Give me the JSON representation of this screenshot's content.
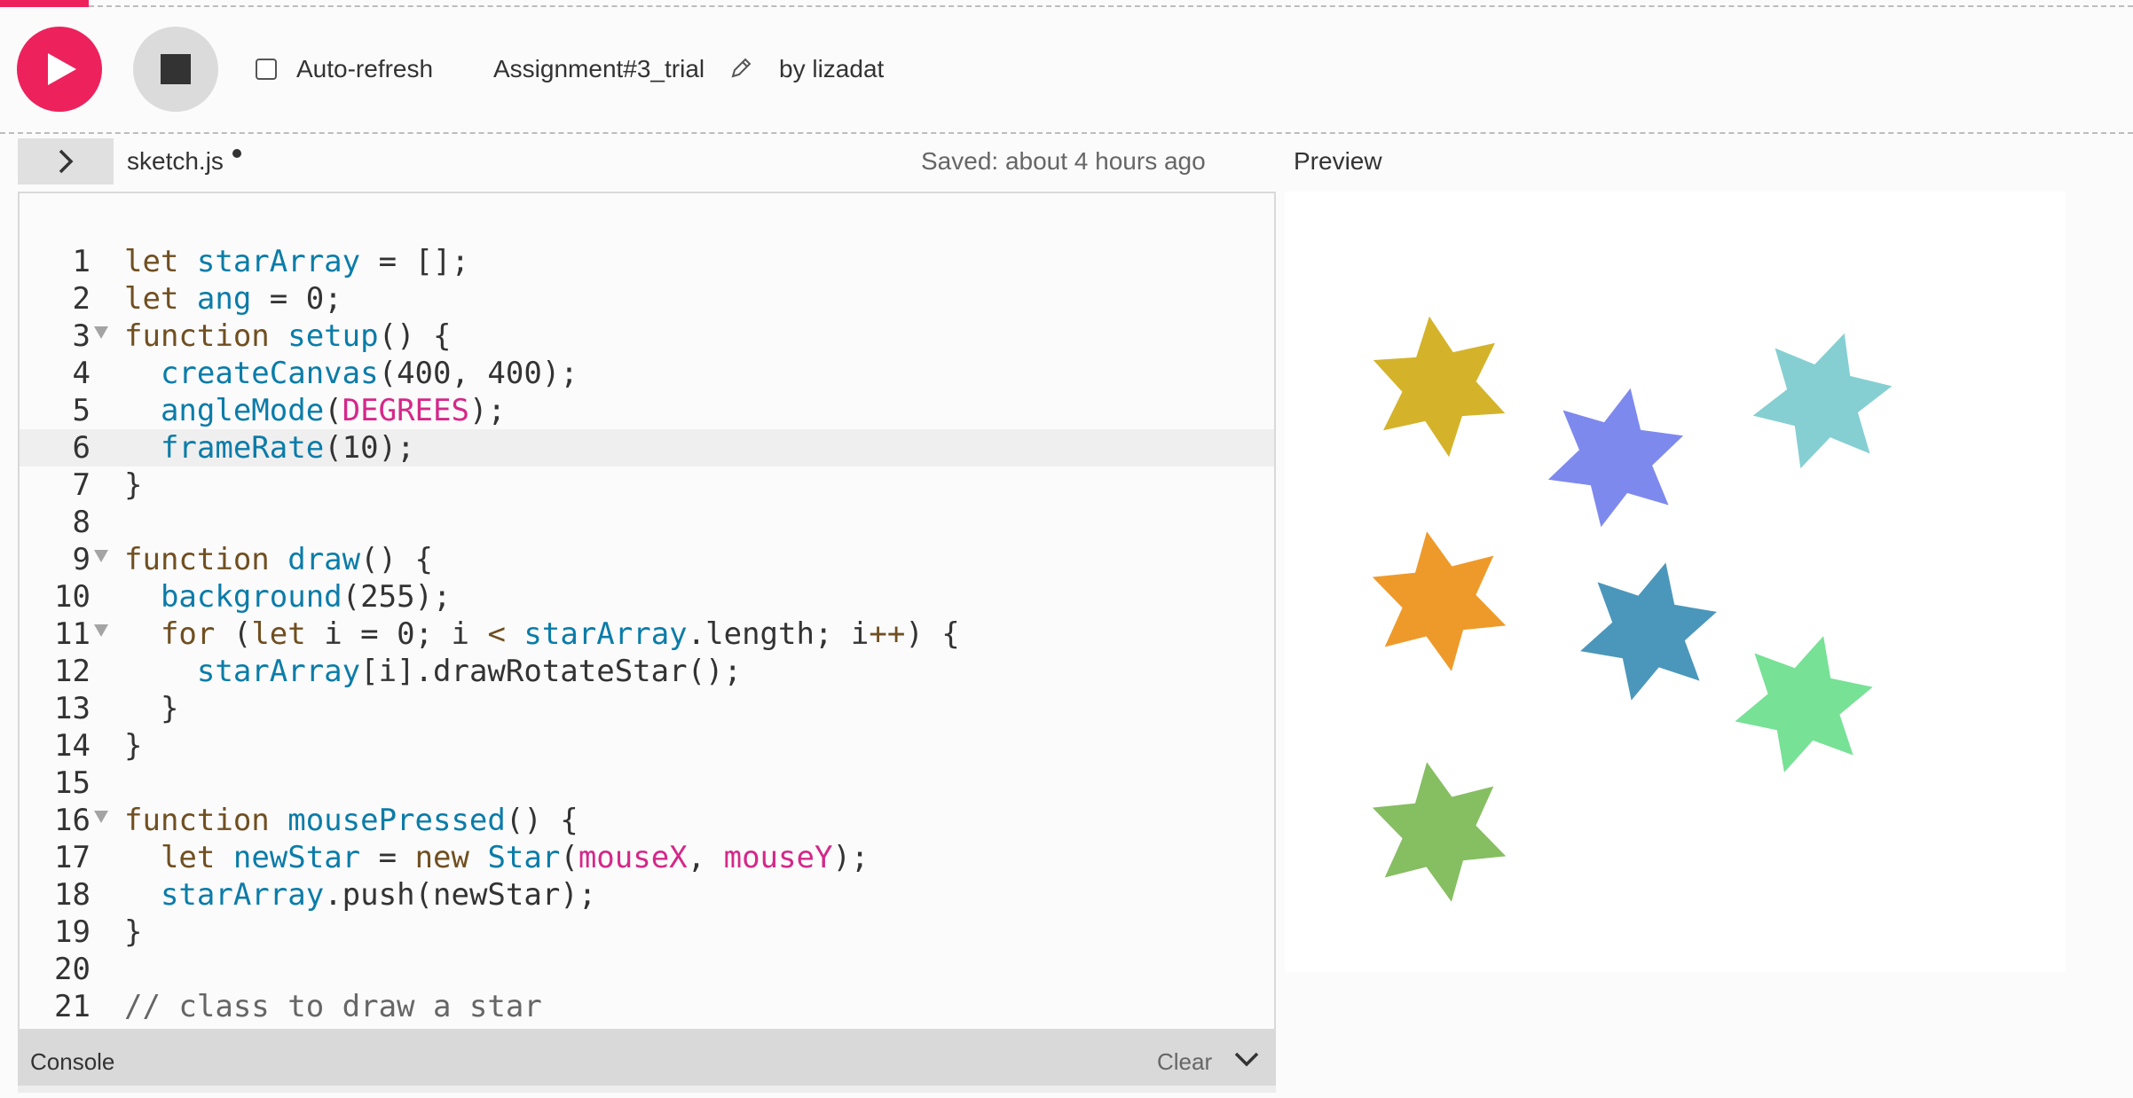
{
  "toolbar": {
    "play_label": "Play",
    "stop_label": "Stop",
    "autorefresh_label": "Auto-refresh",
    "autorefresh_checked": false,
    "project_name": "Assignment#3_trial",
    "byline": "by lizadat"
  },
  "editor": {
    "file_name": "sketch.js",
    "unsaved": true,
    "saved_status": "Saved: about 4 hours ago",
    "active_line": 6,
    "lines": [
      {
        "n": "1",
        "fold": false,
        "tokens": [
          [
            "kw",
            "let "
          ],
          [
            "var",
            "starArray"
          ],
          [
            "punc",
            " = [];"
          ]
        ]
      },
      {
        "n": "2",
        "fold": false,
        "tokens": [
          [
            "kw",
            "let "
          ],
          [
            "var",
            "ang"
          ],
          [
            "punc",
            " = 0;"
          ]
        ]
      },
      {
        "n": "3",
        "fold": true,
        "tokens": [
          [
            "kw",
            "function "
          ],
          [
            "fn",
            "setup"
          ],
          [
            "punc",
            "() {"
          ]
        ]
      },
      {
        "n": "4",
        "fold": false,
        "tokens": [
          [
            "punc",
            "  "
          ],
          [
            "fn",
            "createCanvas"
          ],
          [
            "punc",
            "(400, 400);"
          ]
        ]
      },
      {
        "n": "5",
        "fold": false,
        "tokens": [
          [
            "punc",
            "  "
          ],
          [
            "fn",
            "angleMode"
          ],
          [
            "punc",
            "("
          ],
          [
            "const",
            "DEGREES"
          ],
          [
            "punc",
            ");"
          ]
        ]
      },
      {
        "n": "6",
        "fold": false,
        "tokens": [
          [
            "punc",
            "  "
          ],
          [
            "fn",
            "frameRate"
          ],
          [
            "punc",
            "(10);"
          ]
        ]
      },
      {
        "n": "7",
        "fold": false,
        "tokens": [
          [
            "punc",
            "}"
          ]
        ]
      },
      {
        "n": "8",
        "fold": false,
        "tokens": []
      },
      {
        "n": "9",
        "fold": true,
        "tokens": [
          [
            "kw",
            "function "
          ],
          [
            "fn",
            "draw"
          ],
          [
            "punc",
            "() {"
          ]
        ]
      },
      {
        "n": "10",
        "fold": false,
        "tokens": [
          [
            "punc",
            "  "
          ],
          [
            "fn",
            "background"
          ],
          [
            "punc",
            "(255);"
          ]
        ]
      },
      {
        "n": "11",
        "fold": true,
        "tokens": [
          [
            "punc",
            "  "
          ],
          [
            "kw",
            "for "
          ],
          [
            "punc",
            "("
          ],
          [
            "kw",
            "let "
          ],
          [
            "punc",
            "i = 0; i "
          ],
          [
            "kw",
            "<"
          ],
          [
            "punc",
            " "
          ],
          [
            "var",
            "starArray"
          ],
          [
            "punc",
            ".length; i"
          ],
          [
            "kw",
            "++"
          ],
          [
            "punc",
            ") {"
          ]
        ]
      },
      {
        "n": "12",
        "fold": false,
        "tokens": [
          [
            "punc",
            "    "
          ],
          [
            "var",
            "starArray"
          ],
          [
            "punc",
            "[i].drawRotateStar();"
          ]
        ]
      },
      {
        "n": "13",
        "fold": false,
        "tokens": [
          [
            "punc",
            "  }"
          ]
        ]
      },
      {
        "n": "14",
        "fold": false,
        "tokens": [
          [
            "punc",
            "}"
          ]
        ]
      },
      {
        "n": "15",
        "fold": false,
        "tokens": []
      },
      {
        "n": "16",
        "fold": true,
        "tokens": [
          [
            "kw",
            "function "
          ],
          [
            "fn",
            "mousePressed"
          ],
          [
            "punc",
            "() {"
          ]
        ]
      },
      {
        "n": "17",
        "fold": false,
        "tokens": [
          [
            "punc",
            "  "
          ],
          [
            "kw",
            "let "
          ],
          [
            "var",
            "newStar"
          ],
          [
            "punc",
            " = "
          ],
          [
            "kw",
            "new "
          ],
          [
            "fn",
            "Star"
          ],
          [
            "punc",
            "("
          ],
          [
            "const",
            "mouseX"
          ],
          [
            "punc",
            ", "
          ],
          [
            "const",
            "mouseY"
          ],
          [
            "punc",
            ");"
          ]
        ]
      },
      {
        "n": "18",
        "fold": false,
        "tokens": [
          [
            "punc",
            "  "
          ],
          [
            "var",
            "starArray"
          ],
          [
            "punc",
            ".push(newStar);"
          ]
        ]
      },
      {
        "n": "19",
        "fold": false,
        "tokens": [
          [
            "punc",
            "}"
          ]
        ]
      },
      {
        "n": "20",
        "fold": false,
        "tokens": []
      },
      {
        "n": "21",
        "fold": false,
        "tokens": [
          [
            "cm",
            "// class to draw a star"
          ]
        ]
      }
    ]
  },
  "console": {
    "label": "Console",
    "clear_label": "Clear"
  },
  "preview": {
    "label": "Preview",
    "stars": [
      {
        "color": "#d4b32b"
      },
      {
        "color": "#7e89ee"
      },
      {
        "color": "#85cfd2"
      },
      {
        "color": "#ee9a2a"
      },
      {
        "color": "#4b97bb"
      },
      {
        "color": "#77e196"
      },
      {
        "color": "#86be62"
      }
    ]
  },
  "colors": {
    "accent": "#ed225d",
    "keyword": "#704f21",
    "variable": "#0b7ca9",
    "constant": "#d52889"
  }
}
